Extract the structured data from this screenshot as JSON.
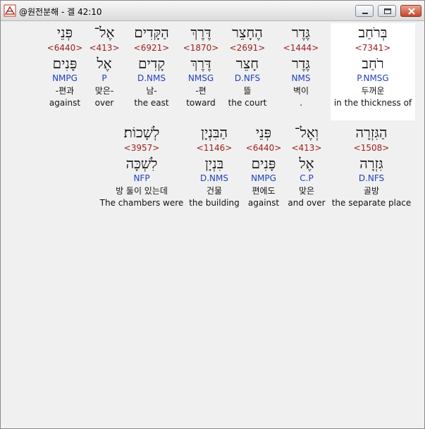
{
  "window": {
    "title": "@원전분해 - 겔 42:10",
    "icon": "bible-app-icon"
  },
  "row1": [
    {
      "heb": "בְּרֹחַב",
      "strong": "<7341>",
      "lemma": "רֹחַב",
      "morph": "P.NMSG",
      "kor": "두꺼운",
      "eng": "in the thickness of"
    },
    {
      "heb": "גֶּדֶר",
      "strong": "<1444>",
      "lemma": "גֶּדֶר",
      "morph": "NMS",
      "kor": "벽이",
      "eng": "."
    },
    {
      "heb": "הֶחָצֵר",
      "strong": "<2691>",
      "lemma": "חָצֵר",
      "morph": "D.NFS",
      "kor": "뜰",
      "eng": "the court"
    },
    {
      "heb": "דֶּרֶךְ",
      "strong": "<1870>",
      "lemma": "דֶּרֶךְ",
      "morph": "NMSG",
      "kor": "-편",
      "eng": "toward"
    },
    {
      "heb": "הַקָּדִים",
      "strong": "<6921>",
      "lemma": "קָדִים",
      "morph": "D.NMS",
      "kor": "남-",
      "eng": "the east"
    },
    {
      "heb": "אֶל־",
      "strong": "<413>",
      "lemma": "אֶל",
      "morph": "P",
      "kor": "맞은-",
      "eng": "over"
    },
    {
      "heb": "פְּנֵי",
      "strong": "<6440>",
      "lemma": "פָּנִים",
      "morph": "NMPG",
      "kor": "-편과",
      "eng": "against"
    }
  ],
  "row2": [
    {
      "heb": "הַגִּזְרָה",
      "strong": "<1508>",
      "lemma": "גִּזְרָה",
      "morph": "D.NFS",
      "kor": "골방",
      "eng": "the separate place"
    },
    {
      "heb": "וְאֶל־",
      "strong": "<413>",
      "lemma": "אֶל",
      "morph": "C.P",
      "kor": "맞은",
      "eng": "and over"
    },
    {
      "heb": "פְּנֵי",
      "strong": "<6440>",
      "lemma": "פָּנִים",
      "morph": "NMPG",
      "kor": "편에도",
      "eng": "against"
    },
    {
      "heb": "הַבִּנְיָן",
      "strong": "<1146>",
      "lemma": "בִּנְיָן",
      "morph": "D.NMS",
      "kor": "건물",
      "eng": "the building"
    },
    {
      "heb": "לְשָׁכוֹת׃",
      "strong": "<3957>",
      "lemma": "לִשְׁכָּה",
      "morph": "NFP",
      "kor": "방 둘이 있는데",
      "eng": "The chambers were"
    }
  ]
}
